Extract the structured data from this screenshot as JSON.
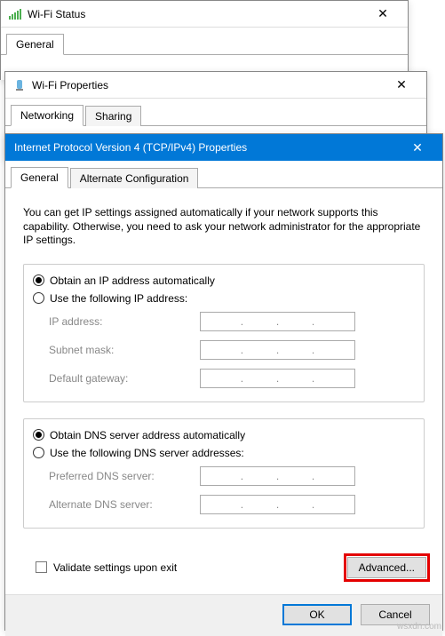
{
  "status_window": {
    "title": "Wi-Fi Status",
    "tab_general": "General"
  },
  "props_window": {
    "title": "Wi-Fi Properties",
    "tab_networking": "Networking",
    "tab_sharing": "Sharing"
  },
  "ipv4_window": {
    "title": "Internet Protocol Version 4 (TCP/IPv4) Properties",
    "tab_general": "General",
    "tab_alt": "Alternate Configuration",
    "description": "You can get IP settings assigned automatically if your network supports this capability. Otherwise, you need to ask your network administrator for the appropriate IP settings.",
    "ip": {
      "auto_label": "Obtain an IP address automatically",
      "manual_label": "Use the following IP address:",
      "ip_address": "IP address:",
      "subnet": "Subnet mask:",
      "gateway": "Default gateway:"
    },
    "dns": {
      "auto_label": "Obtain DNS server address automatically",
      "manual_label": "Use the following DNS server addresses:",
      "preferred": "Preferred DNS server:",
      "alternate": "Alternate DNS server:"
    },
    "validate_label": "Validate settings upon exit",
    "advanced_btn": "Advanced...",
    "ok_btn": "OK",
    "cancel_btn": "Cancel"
  },
  "watermark": "wsxdn.com"
}
